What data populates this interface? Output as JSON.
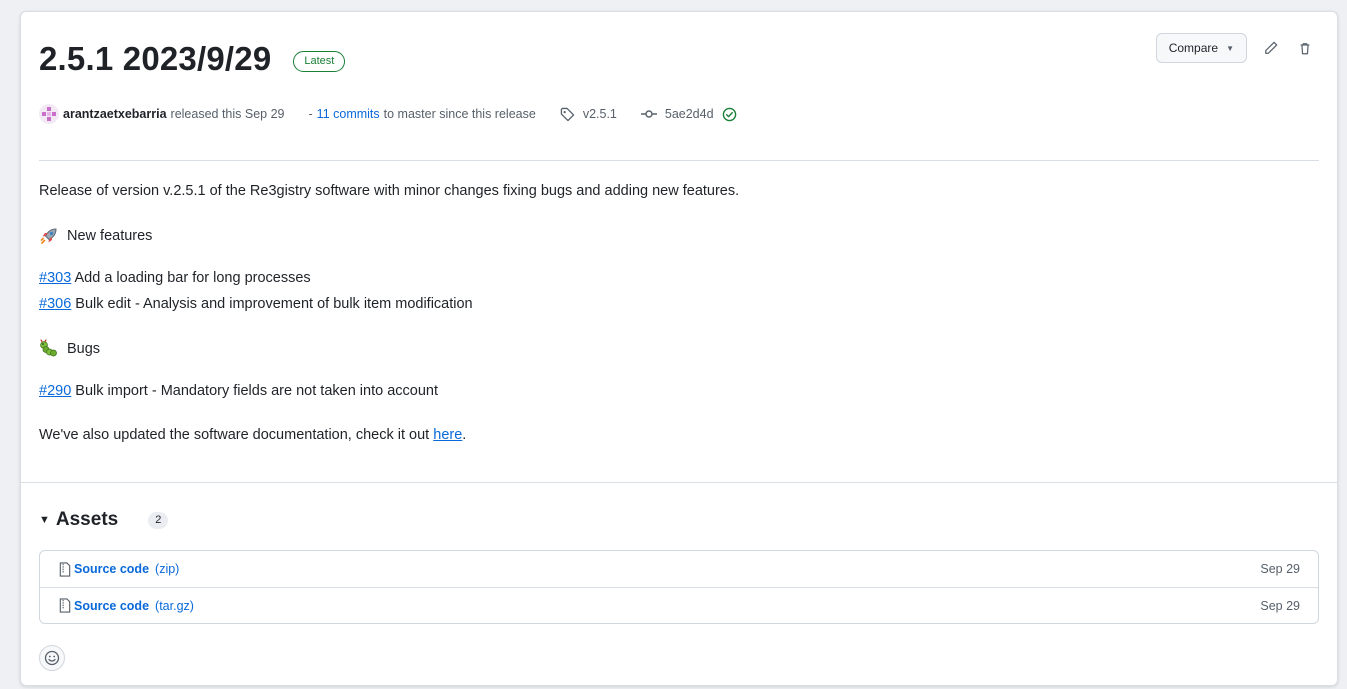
{
  "release": {
    "title": "2.5.1 2023/9/29",
    "badge": "Latest",
    "compare_label": "Compare",
    "author": "arantzaetxebarria",
    "released_text": "released this Sep 29",
    "commits_prefix": "-",
    "commits_link": "11 commits",
    "commits_suffix": "to master since this release",
    "tag": "v2.5.1",
    "commit_sha": "5ae2d4d"
  },
  "body": {
    "description": "Release of version v.2.5.1 of the Re3gistry software with minor changes fixing bugs and adding new features.",
    "features_heading": "New features",
    "features": [
      {
        "ref": "#303",
        "text": "Add a loading bar for long processes"
      },
      {
        "ref": "#306",
        "text": "Bulk edit - Analysis and improvement of bulk item modification"
      }
    ],
    "bugs_heading": "Bugs",
    "bugs": [
      {
        "ref": "#290",
        "text": "Bulk import - Mandatory fields are not taken into account"
      }
    ],
    "docs_prefix": "We've also updated the software documentation, check it out",
    "docs_link": "here",
    "docs_suffix": "."
  },
  "assets": {
    "title": "Assets",
    "count": "2",
    "items": [
      {
        "name": "Source code",
        "format": "(zip)",
        "date": "Sep 29"
      },
      {
        "name": "Source code",
        "format": "(tar.gz)",
        "date": "Sep 29"
      }
    ]
  },
  "icons": {
    "compare_caret": "caret-down-icon",
    "edit": "pencil-icon",
    "delete": "trash-icon",
    "tag": "tag-icon",
    "commit": "git-commit-icon",
    "verified": "check-circle-icon",
    "features": "rocket-icon",
    "bugs": "caterpillar-icon",
    "asset": "file-zip-icon",
    "reaction": "smiley-icon"
  },
  "colors": {
    "link": "#0969da",
    "latest": "#1a7f37",
    "border": "#d0d7de"
  }
}
